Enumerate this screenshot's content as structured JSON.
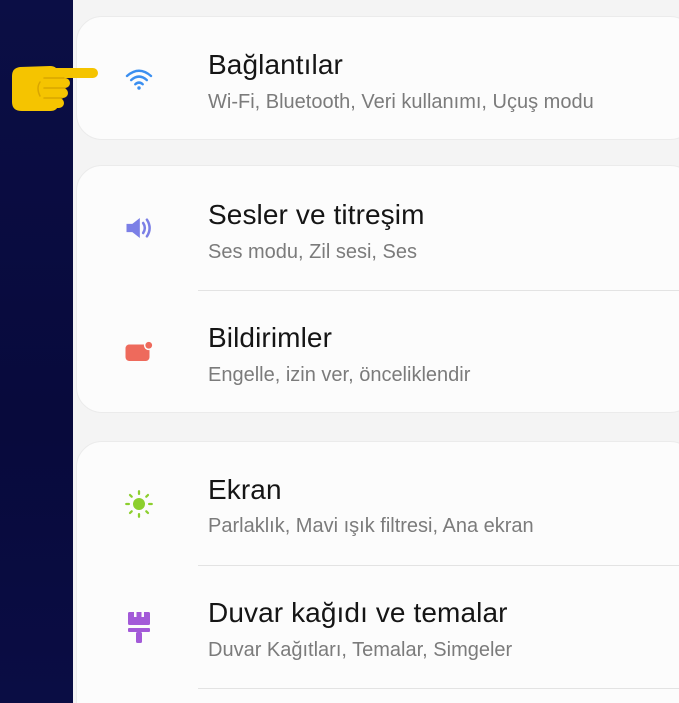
{
  "settings": {
    "items": [
      {
        "title": "Bağlantılar",
        "subtitle": "Wi-Fi, Bluetooth, Veri kullanımı, Uçuş modu",
        "icon": "wifi-icon",
        "color": "#3b8ff0"
      },
      {
        "title": "Sesler ve titreşim",
        "subtitle": "Ses modu, Zil sesi, Ses",
        "icon": "speaker-icon",
        "color": "#7b7fe6"
      },
      {
        "title": "Bildirimler",
        "subtitle": "Engelle, izin ver, önceliklendir",
        "icon": "notification-icon",
        "color": "#ee6a5c"
      },
      {
        "title": "Ekran",
        "subtitle": "Parlaklık, Mavi ışık filtresi, Ana ekran",
        "icon": "brightness-icon",
        "color": "#8ccf2e"
      },
      {
        "title": "Duvar kağıdı ve temalar",
        "subtitle": "Duvar Kağıtları, Temalar, Simgeler",
        "icon": "paint-roller-icon",
        "color": "#a35ad8"
      }
    ]
  },
  "overlay": {
    "pointer_icon": "pointing-hand-icon",
    "pointer_color": "#f5c400"
  }
}
